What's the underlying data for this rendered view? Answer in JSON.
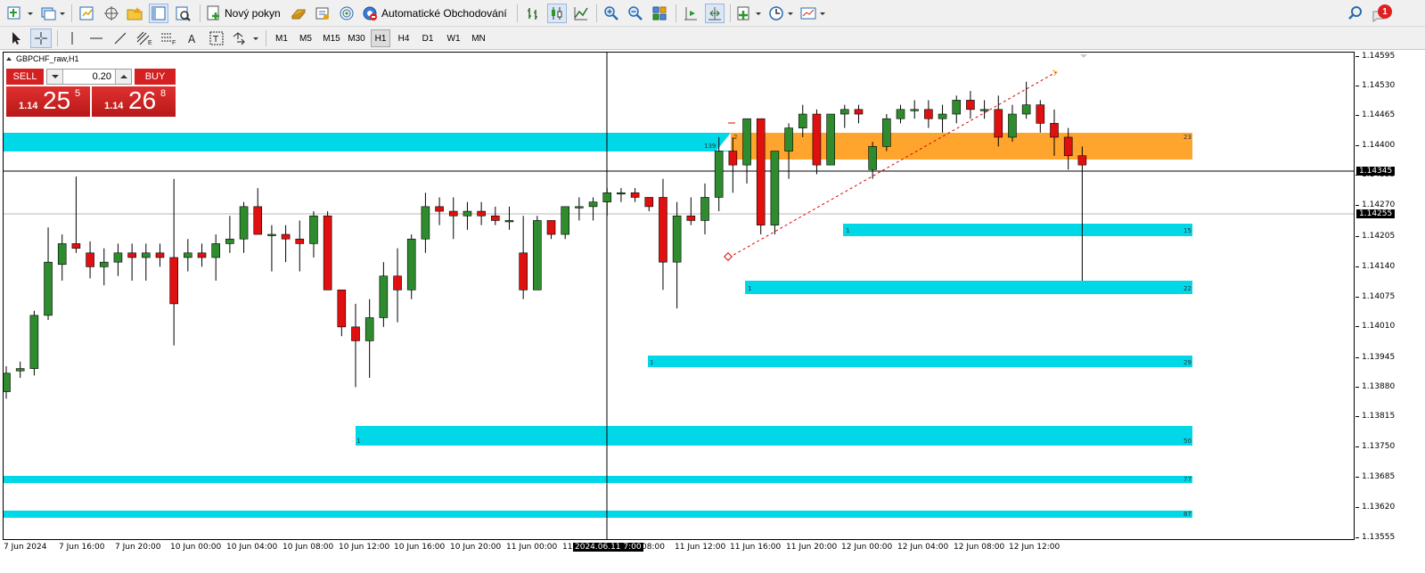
{
  "toolbar": {
    "new_order_label": "Nový pokyn",
    "algo_trading_label": "Automatické Obchodování",
    "notification_count": "1",
    "timeframes": [
      "M1",
      "M5",
      "M15",
      "M30",
      "H1",
      "H4",
      "D1",
      "W1",
      "MN"
    ],
    "active_timeframe": "H1"
  },
  "chart": {
    "symbol_label": "GBPCHF_raw,H1",
    "crosshair_price": "1.14345",
    "bid_price": "1.14255",
    "crosshair_time": "2024.06.11 7:00",
    "y_ticks": [
      "1.14595",
      "1.14530",
      "1.14465",
      "1.14400",
      "1.14335",
      "1.14270",
      "1.14205",
      "1.14140",
      "1.14075",
      "1.14010",
      "1.13945",
      "1.13880",
      "1.13815",
      "1.13750",
      "1.13685",
      "1.13620",
      "1.13555"
    ],
    "x_labels": [
      "7 Jun 2024",
      "7 Jun 16:00",
      "7 Jun 20:00",
      "10 Jun 00:00",
      "10 Jun 04:00",
      "10 Jun 08:00",
      "10 Jun 12:00",
      "10 Jun 16:00",
      "10 Jun 20:00",
      "11 Jun 00:00",
      "11",
      "08:00",
      "11 Jun 12:00",
      "11 Jun 16:00",
      "11 Jun 20:00",
      "12 Jun 00:00",
      "12 Jun 04:00",
      "12 Jun 08:00",
      "12 Jun 12:00"
    ],
    "zone_labels": {
      "zone_top_left": "139",
      "zone_orange_left": "2",
      "zone_orange_right": "23",
      "zone_a_left": "1",
      "zone_a_right": "15",
      "zone_b_left": "1",
      "zone_b_right": "22",
      "zone_c_left": "1",
      "zone_c_right": "29",
      "zone_d_left": "1",
      "zone_d_right": "50",
      "zone_e_right": "77",
      "zone_f_right": "87"
    },
    "colors": {
      "bull": "#2e8b2e",
      "bear": "#e01010",
      "zone": "#00d8e8",
      "supply": "#ffa52e",
      "trend": "#e00000"
    }
  },
  "one_click": {
    "sell_label": "SELL",
    "buy_label": "BUY",
    "volume": "0.20",
    "sell_big": "1.14",
    "sell_main": "25",
    "sell_sup": "5",
    "buy_big": "1.14",
    "buy_main": "26",
    "buy_sup": "8"
  },
  "candles": [
    [
      1.1376,
      1.13815,
      1.13745,
      1.138
    ],
    [
      1.13805,
      1.13825,
      1.1379,
      1.1381
    ],
    [
      1.1381,
      1.13935,
      1.13795,
      1.13925
    ],
    [
      1.13925,
      1.14115,
      1.13915,
      1.1404
    ],
    [
      1.14035,
      1.141,
      1.14,
      1.1408
    ],
    [
      1.1408,
      1.14225,
      1.1406,
      1.1407
    ],
    [
      1.1406,
      1.14085,
      1.14005,
      1.1403
    ],
    [
      1.1403,
      1.1407,
      1.1399,
      1.1404
    ],
    [
      1.1404,
      1.1408,
      1.1401,
      1.1406
    ],
    [
      1.1406,
      1.1408,
      1.14,
      1.1405
    ],
    [
      1.1405,
      1.1408,
      1.14,
      1.1406
    ],
    [
      1.1406,
      1.1408,
      1.1403,
      1.1405
    ],
    [
      1.1405,
      1.1422,
      1.1386,
      1.1395
    ],
    [
      1.1405,
      1.1409,
      1.1402,
      1.1406
    ],
    [
      1.1406,
      1.1408,
      1.1403,
      1.1405
    ],
    [
      1.1405,
      1.141,
      1.14,
      1.1408
    ],
    [
      1.1408,
      1.1414,
      1.1406,
      1.1409
    ],
    [
      1.1409,
      1.1417,
      1.1406,
      1.1416
    ],
    [
      1.1416,
      1.142,
      1.141,
      1.141
    ],
    [
      1.141,
      1.1412,
      1.1402,
      1.141
    ],
    [
      1.141,
      1.1412,
      1.1404,
      1.1409
    ],
    [
      1.1409,
      1.1413,
      1.1402,
      1.1408
    ],
    [
      1.1408,
      1.1415,
      1.1405,
      1.1414
    ],
    [
      1.1414,
      1.1415,
      1.1399,
      1.1398
    ],
    [
      1.1398,
      1.1398,
      1.1388,
      1.139
    ],
    [
      1.139,
      1.1395,
      1.1377,
      1.1387
    ],
    [
      1.1387,
      1.1396,
      1.1379,
      1.1392
    ],
    [
      1.1392,
      1.1404,
      1.139,
      1.1401
    ],
    [
      1.1401,
      1.1407,
      1.1391,
      1.1398
    ],
    [
      1.1398,
      1.141,
      1.1396,
      1.1409
    ],
    [
      1.1409,
      1.1419,
      1.1406,
      1.1416
    ],
    [
      1.1416,
      1.1418,
      1.1412,
      1.1415
    ],
    [
      1.1415,
      1.1418,
      1.1409,
      1.1414
    ],
    [
      1.1414,
      1.1417,
      1.1411,
      1.1415
    ],
    [
      1.1415,
      1.1417,
      1.1412,
      1.1414
    ],
    [
      1.1414,
      1.1416,
      1.1412,
      1.1413
    ],
    [
      1.1413,
      1.1416,
      1.1411,
      1.1413
    ],
    [
      1.1406,
      1.1414,
      1.1396,
      1.1398
    ],
    [
      1.1398,
      1.1414,
      1.1398,
      1.1413
    ],
    [
      1.1413,
      1.1413,
      1.1409,
      1.141
    ],
    [
      1.141,
      1.1416,
      1.1409,
      1.1416
    ],
    [
      1.1416,
      1.1418,
      1.1413,
      1.1416
    ],
    [
      1.1416,
      1.1418,
      1.1413,
      1.1417
    ],
    [
      1.1417,
      1.142,
      1.1414,
      1.1419
    ],
    [
      1.1419,
      1.142,
      1.1417,
      1.1419
    ],
    [
      1.1419,
      1.142,
      1.1417,
      1.1418
    ],
    [
      1.1418,
      1.1418,
      1.1415,
      1.1416
    ],
    [
      1.1418,
      1.1422,
      1.1398,
      1.1404
    ],
    [
      1.1404,
      1.1417,
      1.1394,
      1.1414
    ],
    [
      1.1414,
      1.1418,
      1.1412,
      1.1413
    ],
    [
      1.1413,
      1.1421,
      1.141,
      1.1418
    ],
    [
      1.1418,
      1.1431,
      1.1415,
      1.1428
    ],
    [
      1.1428,
      1.1431,
      1.1419,
      1.1425
    ],
    [
      1.1425,
      1.1435,
      1.1421,
      1.1435
    ],
    [
      1.1435,
      1.1435,
      1.141,
      1.1412
    ],
    [
      1.1412,
      1.1428,
      1.141,
      1.1428
    ],
    [
      1.1428,
      1.1434,
      1.1422,
      1.1433
    ],
    [
      1.1433,
      1.1438,
      1.1431,
      1.1436
    ],
    [
      1.1436,
      1.1437,
      1.1423,
      1.1425
    ],
    [
      1.1425,
      1.1436,
      1.1425,
      1.1436
    ],
    [
      1.1436,
      1.1438,
      1.1433,
      1.1437
    ],
    [
      1.1437,
      1.1438,
      1.1434,
      1.1436
    ],
    [
      1.1424,
      1.143,
      1.1422,
      1.1429
    ],
    [
      1.1429,
      1.1436,
      1.1428,
      1.1435
    ],
    [
      1.1435,
      1.1438,
      1.1434,
      1.1437
    ],
    [
      1.1437,
      1.1439,
      1.1435,
      1.1437
    ],
    [
      1.1437,
      1.1439,
      1.1433,
      1.1435
    ],
    [
      1.1435,
      1.1438,
      1.1432,
      1.1436
    ],
    [
      1.1436,
      1.144,
      1.1434,
      1.1439
    ],
    [
      1.1439,
      1.1441,
      1.1435,
      1.1437
    ],
    [
      1.1437,
      1.1439,
      1.1435,
      1.1437
    ],
    [
      1.1437,
      1.144,
      1.1429,
      1.1431
    ],
    [
      1.1431,
      1.1438,
      1.143,
      1.1436
    ],
    [
      1.1436,
      1.1443,
      1.1435,
      1.1438
    ],
    [
      1.1438,
      1.1439,
      1.1432,
      1.1434
    ],
    [
      1.1434,
      1.1437,
      1.1427,
      1.1431
    ],
    [
      1.1431,
      1.1433,
      1.1424,
      1.1427
    ],
    [
      1.1427,
      1.1429,
      1.14,
      1.1425
    ]
  ]
}
